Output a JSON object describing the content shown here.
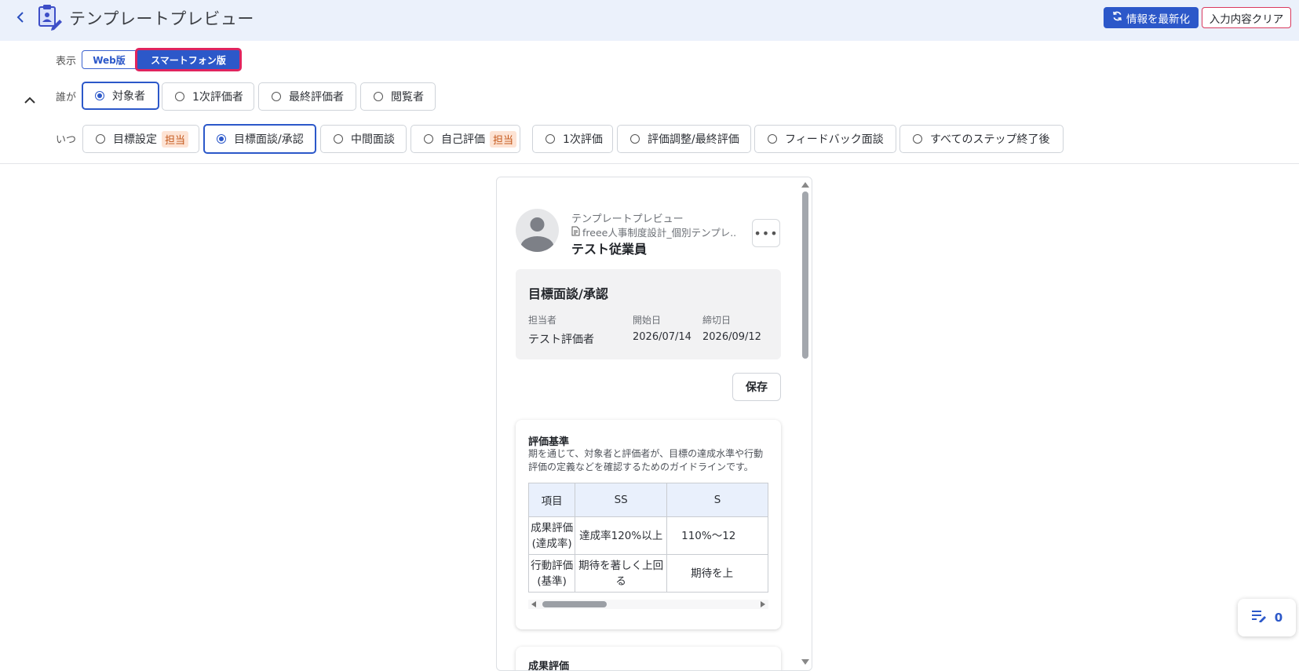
{
  "header": {
    "title": "テンプレートプレビュー",
    "refresh_label": "情報を最新化",
    "clear_label": "入力内容クリア"
  },
  "filters": {
    "display_label": "表示",
    "display_options": [
      "Web版",
      "スマートフォン版"
    ],
    "display_selected": "スマートフォン版",
    "who_label": "誰が",
    "who_options": [
      "対象者",
      "1次評価者",
      "最終評価者",
      "閲覧者"
    ],
    "who_selected": "対象者",
    "when_label": "いつ",
    "when_options": [
      "目標設定",
      "目標面談/承認",
      "中間面談",
      "自己評価",
      "1次評価",
      "評価調整/最終評価",
      "フィードバック面談",
      "すべてのステップ終了後"
    ],
    "when_selected": "目標面談/承認",
    "tag_label": "担当"
  },
  "preview": {
    "subtitle": "テンプレートプレビュー",
    "template_name": "freee人事制度設計_個別テンプレ...",
    "employee_name": "テスト従業員",
    "more_label": "•••",
    "step": {
      "title": "目標面談/承認",
      "assignee_label": "担当者",
      "assignee": "テスト評価者",
      "start_label": "開始日",
      "start_date": "2026/07/14",
      "due_label": "締切日",
      "due_date": "2026/09/12"
    },
    "save_label": "保存",
    "criteria": {
      "title": "評価基準",
      "description": "期を通じて、対象者と評価者が、目標の達成水準や行動評価の定義などを確認するためのガイドラインです。",
      "headers": [
        "項目",
        "SS",
        "S"
      ],
      "rows": [
        {
          "item": "成果評価\n(達成率)",
          "ss": "達成率120%以上",
          "s": "110%～12"
        },
        {
          "item": "行動評価\n(基準)",
          "ss": "期待を著しく上回る",
          "s": "期待を上"
        }
      ]
    },
    "next_card_title": "成果評価"
  },
  "fab": {
    "count": "0"
  },
  "colors": {
    "primary": "#2c58c9",
    "highlight_border": "#e0245e",
    "header_bg": "#ebf1fb",
    "tag_bg": "#fde3d4"
  }
}
